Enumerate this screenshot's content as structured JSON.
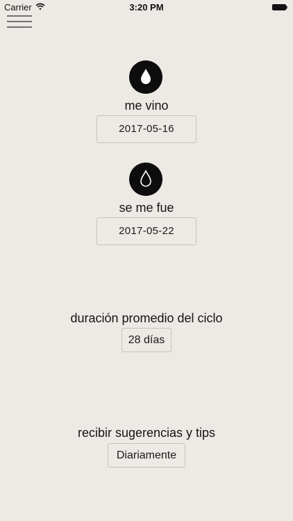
{
  "status_bar": {
    "carrier": "Carrier",
    "time": "3:20 PM",
    "icons": [
      "wifi-icon",
      "battery-icon"
    ]
  },
  "menu": {
    "icon": "hamburger-menu-icon"
  },
  "period_start": {
    "icon": "filled-drop-icon",
    "label": "me vino",
    "date": "2017-05-16"
  },
  "period_end": {
    "icon": "outline-drop-icon",
    "label": "se me fue",
    "date": "2017-05-22"
  },
  "cycle": {
    "label": "duración promedio del ciclo",
    "value": "28 días"
  },
  "tips": {
    "label": "recibir sugerencias y tips",
    "value": "Diariamente"
  },
  "colors": {
    "background": "#ede9e4",
    "icon_circle": "#0d0d0d",
    "border": "#c5c1bb"
  }
}
